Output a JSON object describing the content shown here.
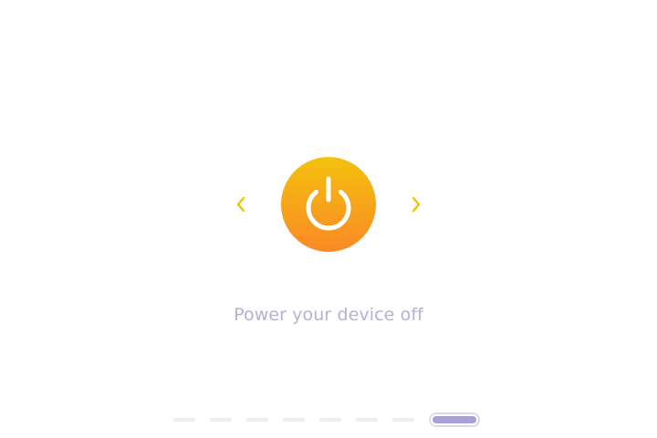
{
  "screen": {
    "caption": "Power your device off"
  },
  "icons": {
    "power": "power-icon",
    "prev": "chevron-left-icon",
    "next": "chevron-right-icon"
  },
  "colors": {
    "accent_top": "#f4c20f",
    "accent_bottom": "#fb8a26",
    "arrow": "#f0c400",
    "caption": "#b6b0d8",
    "pager_active": "#a9a1d6",
    "pager_inactive": "#ececf2"
  },
  "pager": {
    "total_steps": 8,
    "active_step": 8
  }
}
